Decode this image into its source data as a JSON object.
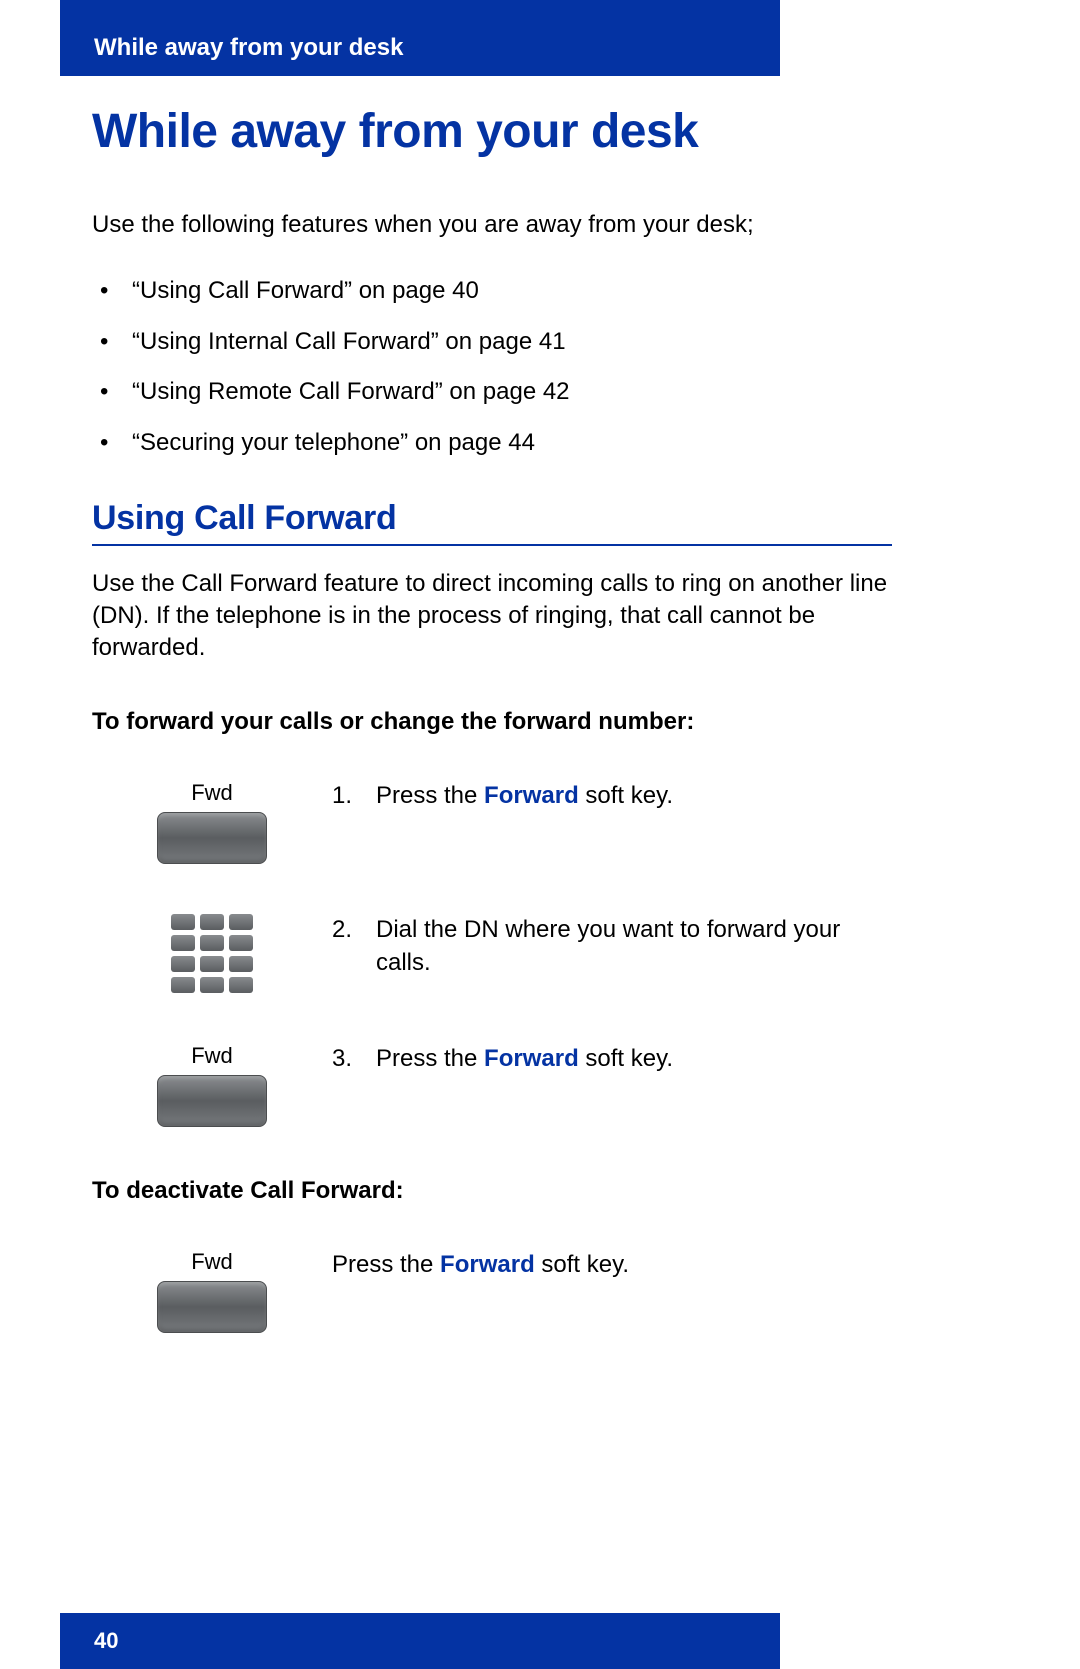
{
  "header": {
    "title": "While away from your desk"
  },
  "h1": "While away from your desk",
  "intro": "Use the following features when you are away from your desk;",
  "toc": [
    "“Using Call Forward” on page 40",
    "“Using Internal Call Forward” on page 41",
    "“Using Remote Call Forward” on page 42",
    "“Securing your telephone” on page 44"
  ],
  "h2": "Using Call Forward",
  "body1": "Use the Call Forward feature to direct incoming calls to ring on another line (DN). If the telephone is in the process of ringing, that call cannot be forwarded.",
  "sub1": "To forward your calls or change the forward number:",
  "steps": [
    {
      "icon": "fwd",
      "label": "Fwd",
      "num": "1.",
      "pre": "Press the ",
      "kw": "Forward",
      "post": " soft key."
    },
    {
      "icon": "keypad",
      "label": "",
      "num": "2.",
      "pre": "Dial the DN where you want to forward your calls.",
      "kw": "",
      "post": ""
    },
    {
      "icon": "fwd",
      "label": "Fwd",
      "num": "3.",
      "pre": "Press the ",
      "kw": "Forward",
      "post": " soft key."
    }
  ],
  "sub2": "To deactivate Call Forward:",
  "deact": {
    "label": "Fwd",
    "pre": "Press the ",
    "kw": "Forward",
    "post": " soft key."
  },
  "page_number": "40"
}
